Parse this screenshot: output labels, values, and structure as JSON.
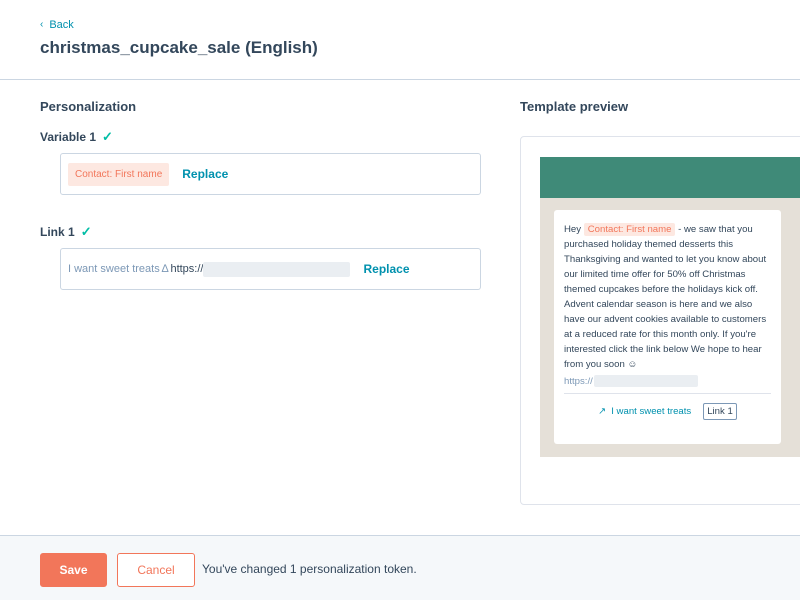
{
  "header": {
    "back_label": "Back",
    "back_icon": "chevron-left-icon",
    "title": "christmas_cupcake_sale (English)"
  },
  "personalization": {
    "section_title": "Personalization",
    "variable": {
      "label": "Variable 1",
      "token": "Contact: First name",
      "replace_label": "Replace"
    },
    "link": {
      "label": "Link 1",
      "text": "I want sweet treats",
      "link_icon": "link-icon",
      "url_prefix": "https://",
      "replace_label": "Replace"
    }
  },
  "preview": {
    "section_title": "Template preview",
    "greeting": "Hey",
    "token": "Contact: First name",
    "body": " - we saw that you purchased holiday themed desserts this Thanksgiving and wanted to let you know about our limited time offer for 50% off Christmas themed cupcakes before the holidays kick off. Advent calendar season is here and we also have our advent cookies available to customers at a reduced rate for this month only. If you're interested click the link below We hope to hear from you soon",
    "url_prefix": "https://",
    "link_text": "I want sweet treats",
    "link_badge": "Link 1"
  },
  "footer": {
    "save_label": "Save",
    "cancel_label": "Cancel",
    "message": "You've changed 1 personalization token."
  },
  "colors": {
    "accent": "#f2765a",
    "link": "#0091ae",
    "success": "#00bda5",
    "text": "#33475b",
    "preview_band": "#3f8a78"
  }
}
